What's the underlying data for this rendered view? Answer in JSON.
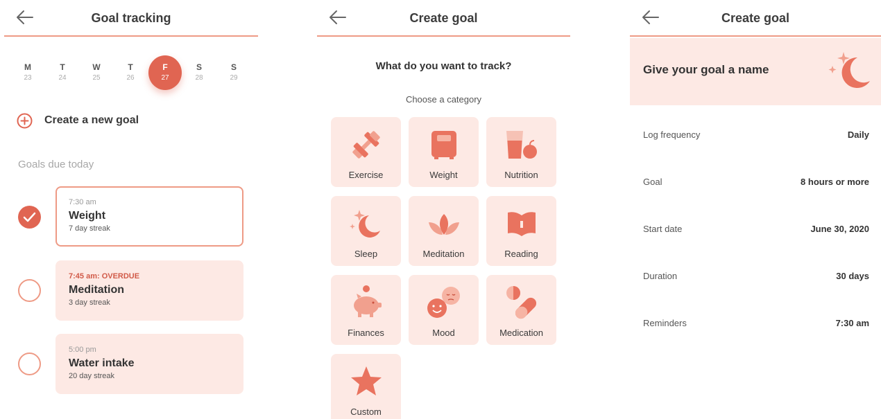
{
  "colors": {
    "accent": "#e06552",
    "accent_light": "#ee9a85",
    "tint": "#fde9e4"
  },
  "screen1": {
    "title": "Goal tracking",
    "week": [
      {
        "letter": "M",
        "date": "23"
      },
      {
        "letter": "T",
        "date": "24"
      },
      {
        "letter": "W",
        "date": "25"
      },
      {
        "letter": "T",
        "date": "26"
      },
      {
        "letter": "F",
        "date": "27",
        "selected": true
      },
      {
        "letter": "S",
        "date": "28"
      },
      {
        "letter": "S",
        "date": "29"
      }
    ],
    "create_label": "Create a new goal",
    "section_label": "Goals due today",
    "goals": [
      {
        "time": "7:30 am",
        "name": "Weight",
        "streak": "7 day streak",
        "done": true,
        "overdue": false
      },
      {
        "time": "7:45 am: OVERDUE",
        "name": "Meditation",
        "streak": "3 day streak",
        "done": false,
        "overdue": true
      },
      {
        "time": "5:00 pm",
        "name": "Water intake",
        "streak": "20 day streak",
        "done": false,
        "overdue": false
      }
    ]
  },
  "screen2": {
    "title": "Create goal",
    "question": "What do you want to track?",
    "subtitle": "Choose a category",
    "categories": [
      {
        "label": "Exercise",
        "icon": "dumbbell-icon"
      },
      {
        "label": "Weight",
        "icon": "scale-icon"
      },
      {
        "label": "Nutrition",
        "icon": "drink-apple-icon"
      },
      {
        "label": "Sleep",
        "icon": "moon-icon"
      },
      {
        "label": "Meditation",
        "icon": "lotus-icon"
      },
      {
        "label": "Reading",
        "icon": "book-icon"
      },
      {
        "label": "Finances",
        "icon": "piggy-bank-icon"
      },
      {
        "label": "Mood",
        "icon": "faces-icon"
      },
      {
        "label": "Medication",
        "icon": "pill-icon"
      },
      {
        "label": "Custom",
        "icon": "star-icon"
      }
    ]
  },
  "screen3": {
    "title": "Create goal",
    "name_prompt": "Give your goal a name",
    "fields": [
      {
        "label": "Log frequency",
        "value": "Daily"
      },
      {
        "label": "Goal",
        "value": "8 hours or more"
      },
      {
        "label": "Start date",
        "value": "June 30, 2020"
      },
      {
        "label": "Duration",
        "value": "30 days"
      },
      {
        "label": "Reminders",
        "value": "7:30 am"
      }
    ]
  }
}
